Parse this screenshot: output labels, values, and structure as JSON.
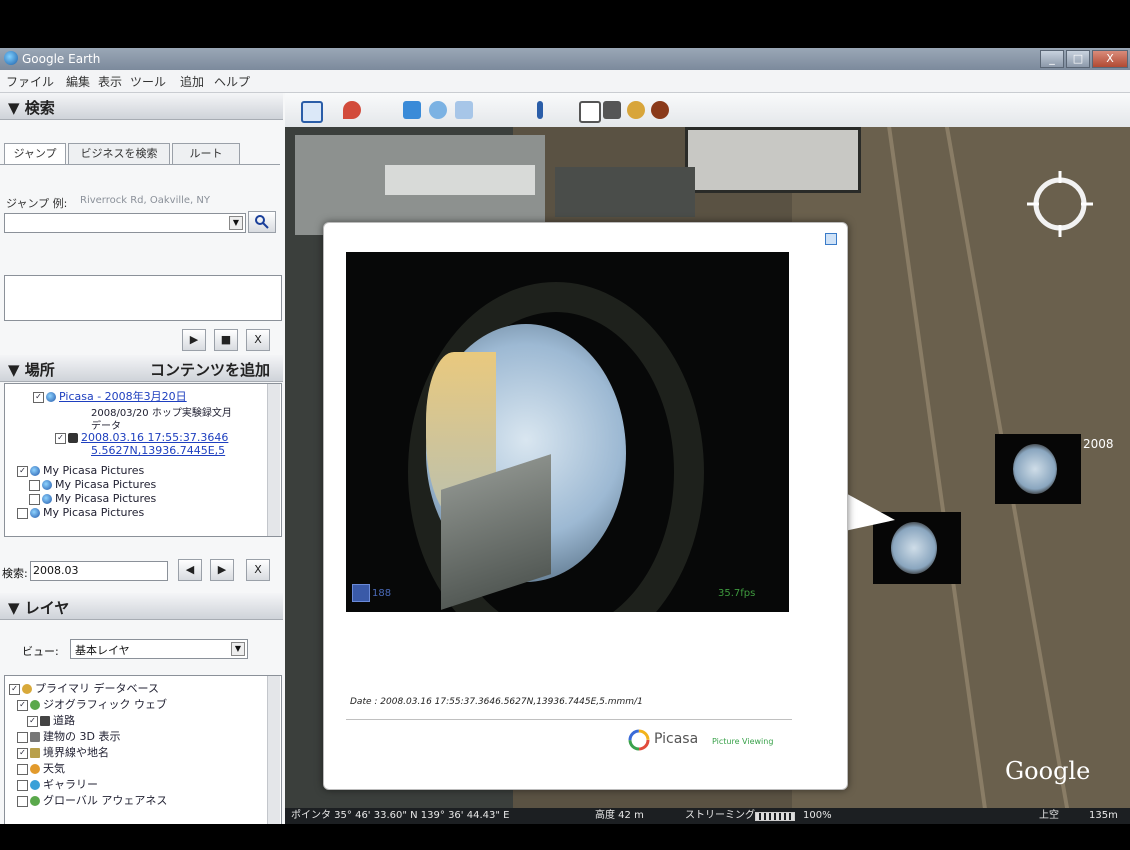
{
  "window": {
    "title": "Google Earth",
    "controls": [
      "_",
      "□",
      "X"
    ]
  },
  "menu": [
    "ファイル",
    "編集",
    "表示",
    "ツール",
    "追加",
    "ヘルプ"
  ],
  "search_panel": {
    "header": "▼ 検索",
    "tabs": [
      "ジャンプ",
      "ビジネスを検索",
      "ルート"
    ],
    "jump_label": "ジャンプ 例:",
    "jump_placeholder": "Riverrock Rd, Oakville, NY",
    "controls": {
      "play": "▶",
      "stop": "■",
      "close": "X"
    }
  },
  "places_panel": {
    "header": "▼ 場所",
    "add_content": "コンテンツを追加",
    "items": [
      {
        "label": "Picasa - 2008年3月20日",
        "link": true
      },
      {
        "label": "2008/03/20 ホップ実験録文月",
        "link": false
      },
      {
        "label": "データ",
        "link": false
      },
      {
        "label": "2008.03.16 17:55:37.3646",
        "link": true
      },
      {
        "label": "5.5627N,13936.7445E,5",
        "link": true
      },
      {
        "label": "My Picasa Pictures",
        "link": false
      },
      {
        "label": "My Picasa Pictures",
        "link": false
      },
      {
        "label": "My Picasa Pictures",
        "link": false
      },
      {
        "label": "My Picasa Pictures",
        "link": false
      }
    ],
    "search_label": "検索:",
    "search_value": "2008.03",
    "nav": {
      "prev": "◀",
      "next": "▶",
      "close": "X"
    }
  },
  "layers_panel": {
    "header": "▼ レイヤ",
    "view_label": "ビュー:",
    "view_value": "基本レイヤ",
    "items": [
      "プライマリ データベース",
      "ジオグラフィック ウェブ",
      "道路",
      "建物の 3D 表示",
      "境界線や地名",
      "天気",
      "ギャラリー",
      "グローバル アウェアネス"
    ]
  },
  "map": {
    "thumb_label": "2008",
    "logo": "Google",
    "status": {
      "pointer": "ポインタ 35° 46' 33.60\" N  139° 36' 44.43\" E",
      "elev": "高度  42 m",
      "streaming": "ストリーミング",
      "percent": "100%",
      "eye": "上空",
      "eye_value": "135m"
    }
  },
  "popup": {
    "photo_corner_left": "188",
    "photo_corner_right": "35.7fps",
    "caption": "Date : 2008.03.16 17:55:37.3646.5627N,13936.7445E,5.mmm/1",
    "brand": "Picasa",
    "brand_sub": "Picture Viewing"
  }
}
